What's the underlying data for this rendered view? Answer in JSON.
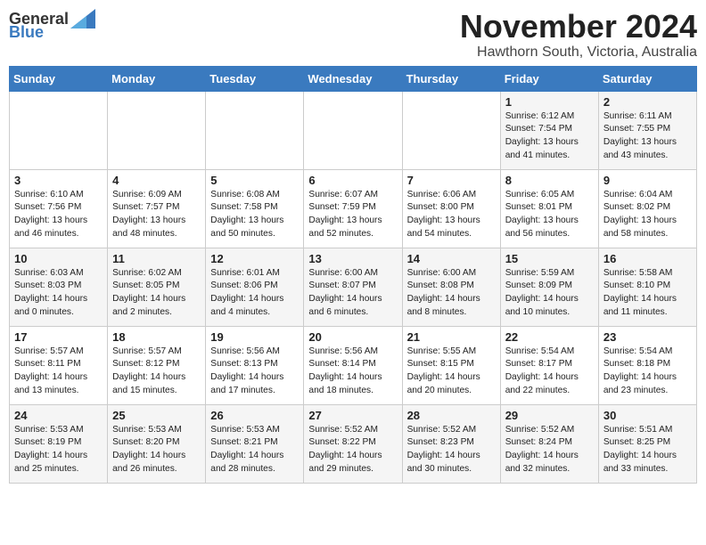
{
  "header": {
    "logo_general": "General",
    "logo_blue": "Blue",
    "month": "November 2024",
    "location": "Hawthorn South, Victoria, Australia"
  },
  "weekdays": [
    "Sunday",
    "Monday",
    "Tuesday",
    "Wednesday",
    "Thursday",
    "Friday",
    "Saturday"
  ],
  "weeks": [
    [
      {
        "day": "",
        "info": ""
      },
      {
        "day": "",
        "info": ""
      },
      {
        "day": "",
        "info": ""
      },
      {
        "day": "",
        "info": ""
      },
      {
        "day": "",
        "info": ""
      },
      {
        "day": "1",
        "info": "Sunrise: 6:12 AM\nSunset: 7:54 PM\nDaylight: 13 hours\nand 41 minutes."
      },
      {
        "day": "2",
        "info": "Sunrise: 6:11 AM\nSunset: 7:55 PM\nDaylight: 13 hours\nand 43 minutes."
      }
    ],
    [
      {
        "day": "3",
        "info": "Sunrise: 6:10 AM\nSunset: 7:56 PM\nDaylight: 13 hours\nand 46 minutes."
      },
      {
        "day": "4",
        "info": "Sunrise: 6:09 AM\nSunset: 7:57 PM\nDaylight: 13 hours\nand 48 minutes."
      },
      {
        "day": "5",
        "info": "Sunrise: 6:08 AM\nSunset: 7:58 PM\nDaylight: 13 hours\nand 50 minutes."
      },
      {
        "day": "6",
        "info": "Sunrise: 6:07 AM\nSunset: 7:59 PM\nDaylight: 13 hours\nand 52 minutes."
      },
      {
        "day": "7",
        "info": "Sunrise: 6:06 AM\nSunset: 8:00 PM\nDaylight: 13 hours\nand 54 minutes."
      },
      {
        "day": "8",
        "info": "Sunrise: 6:05 AM\nSunset: 8:01 PM\nDaylight: 13 hours\nand 56 minutes."
      },
      {
        "day": "9",
        "info": "Sunrise: 6:04 AM\nSunset: 8:02 PM\nDaylight: 13 hours\nand 58 minutes."
      }
    ],
    [
      {
        "day": "10",
        "info": "Sunrise: 6:03 AM\nSunset: 8:03 PM\nDaylight: 14 hours\nand 0 minutes."
      },
      {
        "day": "11",
        "info": "Sunrise: 6:02 AM\nSunset: 8:05 PM\nDaylight: 14 hours\nand 2 minutes."
      },
      {
        "day": "12",
        "info": "Sunrise: 6:01 AM\nSunset: 8:06 PM\nDaylight: 14 hours\nand 4 minutes."
      },
      {
        "day": "13",
        "info": "Sunrise: 6:00 AM\nSunset: 8:07 PM\nDaylight: 14 hours\nand 6 minutes."
      },
      {
        "day": "14",
        "info": "Sunrise: 6:00 AM\nSunset: 8:08 PM\nDaylight: 14 hours\nand 8 minutes."
      },
      {
        "day": "15",
        "info": "Sunrise: 5:59 AM\nSunset: 8:09 PM\nDaylight: 14 hours\nand 10 minutes."
      },
      {
        "day": "16",
        "info": "Sunrise: 5:58 AM\nSunset: 8:10 PM\nDaylight: 14 hours\nand 11 minutes."
      }
    ],
    [
      {
        "day": "17",
        "info": "Sunrise: 5:57 AM\nSunset: 8:11 PM\nDaylight: 14 hours\nand 13 minutes."
      },
      {
        "day": "18",
        "info": "Sunrise: 5:57 AM\nSunset: 8:12 PM\nDaylight: 14 hours\nand 15 minutes."
      },
      {
        "day": "19",
        "info": "Sunrise: 5:56 AM\nSunset: 8:13 PM\nDaylight: 14 hours\nand 17 minutes."
      },
      {
        "day": "20",
        "info": "Sunrise: 5:56 AM\nSunset: 8:14 PM\nDaylight: 14 hours\nand 18 minutes."
      },
      {
        "day": "21",
        "info": "Sunrise: 5:55 AM\nSunset: 8:15 PM\nDaylight: 14 hours\nand 20 minutes."
      },
      {
        "day": "22",
        "info": "Sunrise: 5:54 AM\nSunset: 8:17 PM\nDaylight: 14 hours\nand 22 minutes."
      },
      {
        "day": "23",
        "info": "Sunrise: 5:54 AM\nSunset: 8:18 PM\nDaylight: 14 hours\nand 23 minutes."
      }
    ],
    [
      {
        "day": "24",
        "info": "Sunrise: 5:53 AM\nSunset: 8:19 PM\nDaylight: 14 hours\nand 25 minutes."
      },
      {
        "day": "25",
        "info": "Sunrise: 5:53 AM\nSunset: 8:20 PM\nDaylight: 14 hours\nand 26 minutes."
      },
      {
        "day": "26",
        "info": "Sunrise: 5:53 AM\nSunset: 8:21 PM\nDaylight: 14 hours\nand 28 minutes."
      },
      {
        "day": "27",
        "info": "Sunrise: 5:52 AM\nSunset: 8:22 PM\nDaylight: 14 hours\nand 29 minutes."
      },
      {
        "day": "28",
        "info": "Sunrise: 5:52 AM\nSunset: 8:23 PM\nDaylight: 14 hours\nand 30 minutes."
      },
      {
        "day": "29",
        "info": "Sunrise: 5:52 AM\nSunset: 8:24 PM\nDaylight: 14 hours\nand 32 minutes."
      },
      {
        "day": "30",
        "info": "Sunrise: 5:51 AM\nSunset: 8:25 PM\nDaylight: 14 hours\nand 33 minutes."
      }
    ]
  ]
}
